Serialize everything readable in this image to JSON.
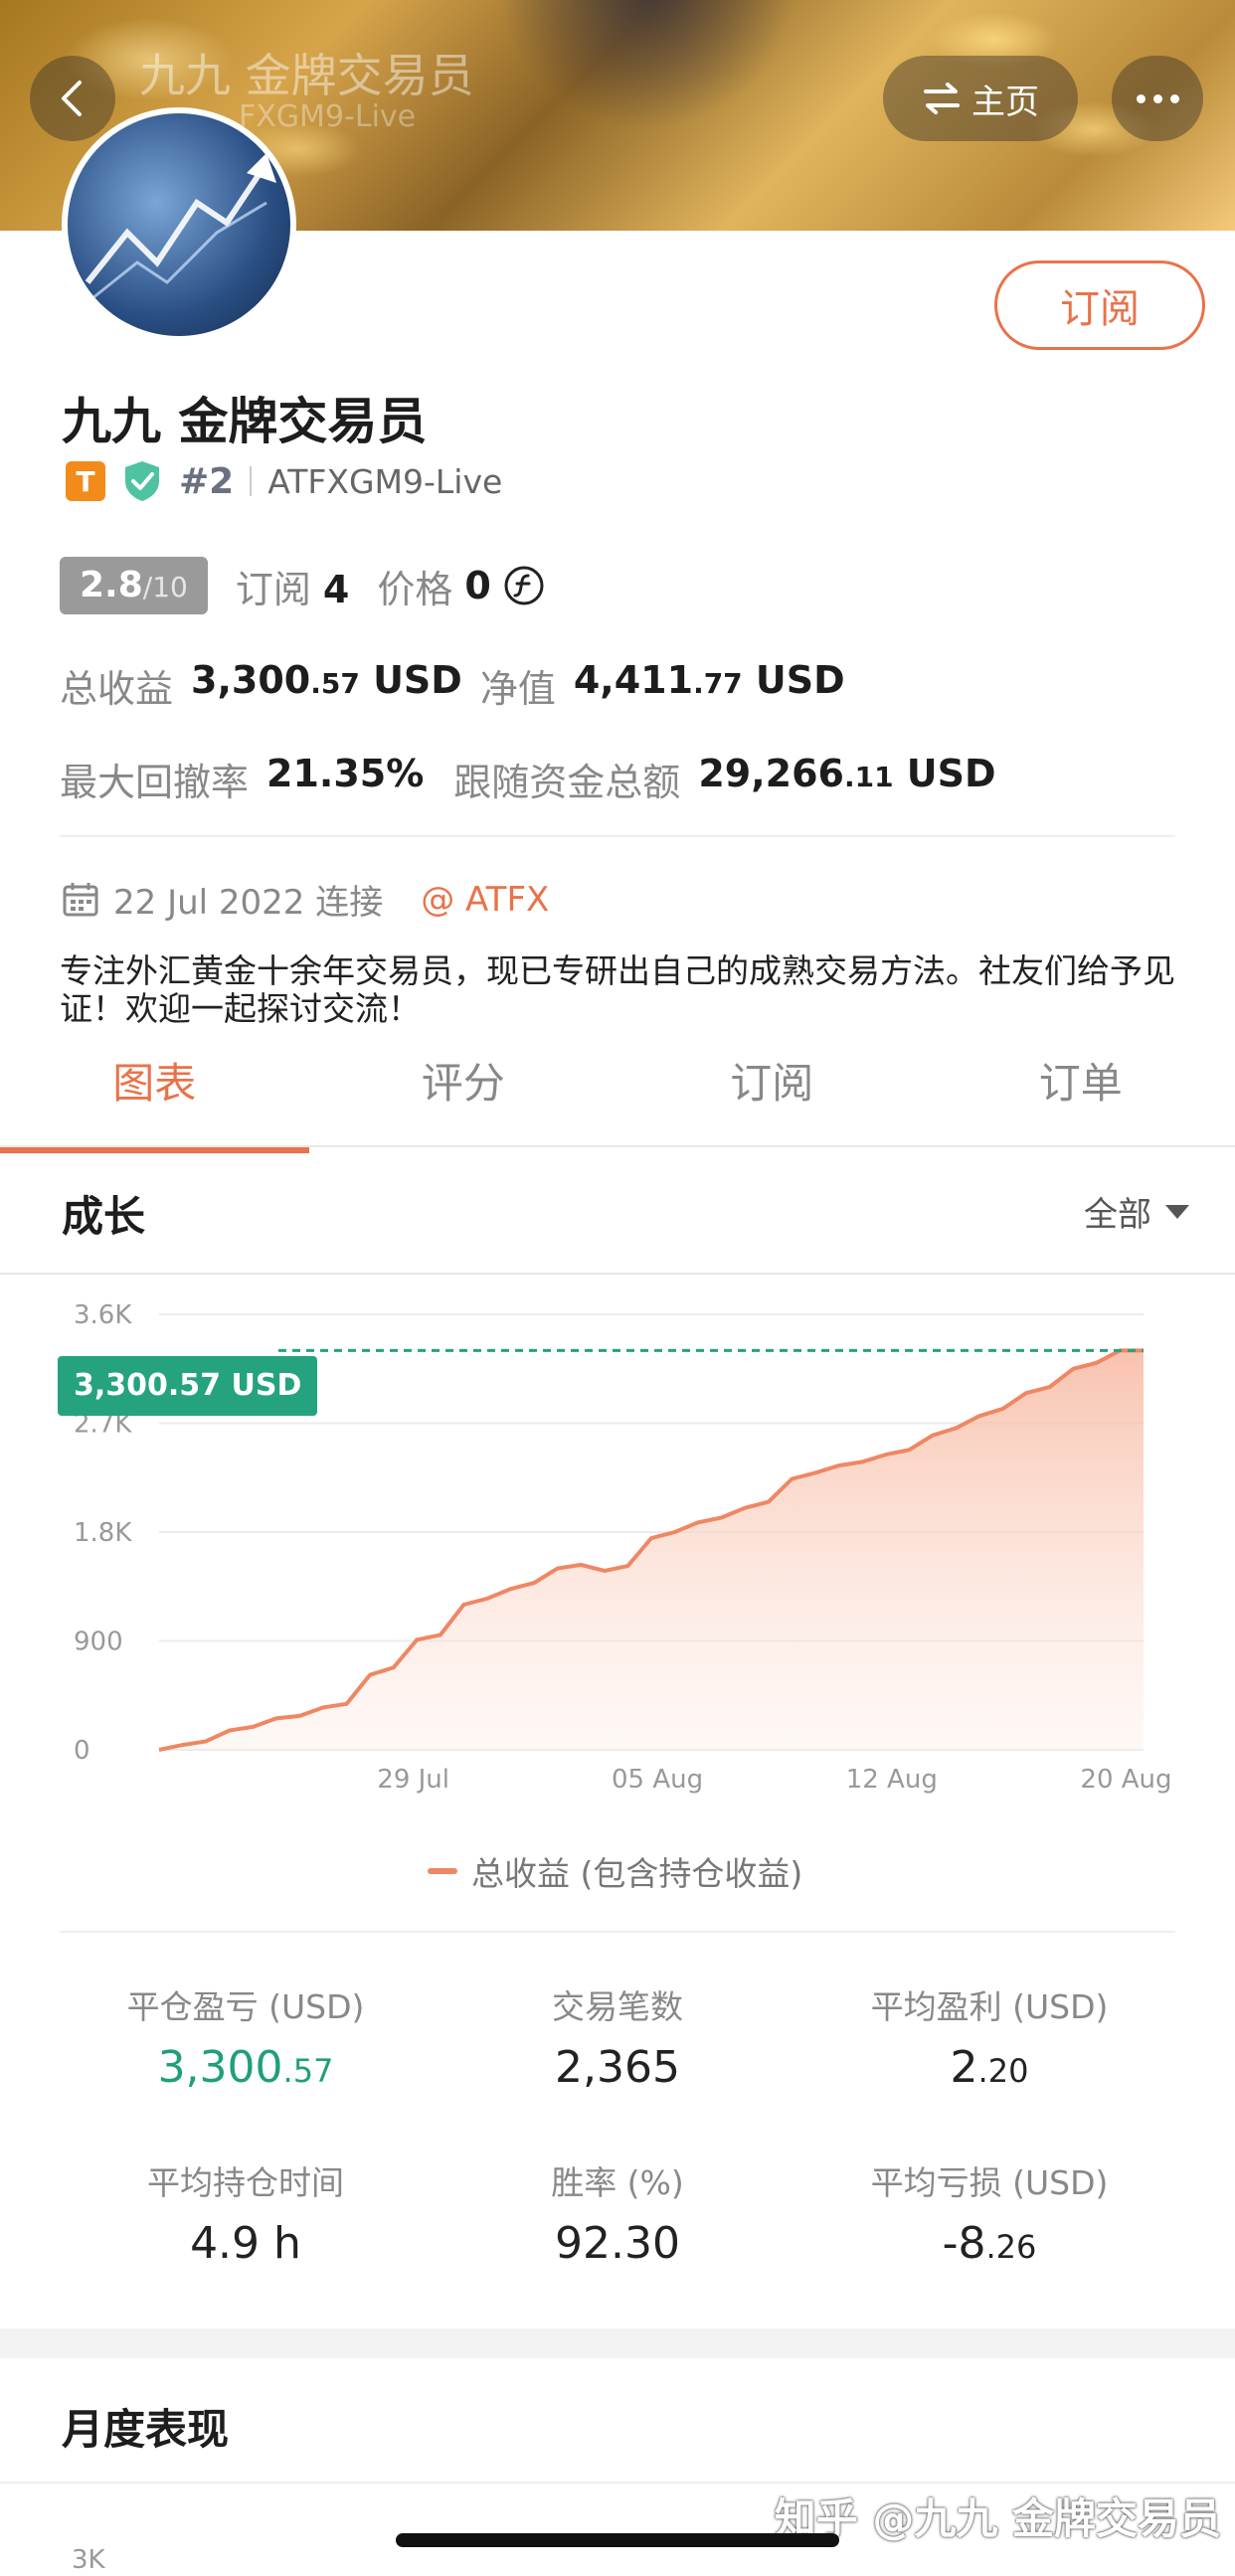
{
  "banner": {
    "faded_title": "九九 金牌交易员",
    "faded_sub": "FXGM9-Live",
    "home_label": "主页"
  },
  "profile": {
    "subscribe_label": "订阅",
    "name": "九九 金牌交易员",
    "tier_badge": "T",
    "rank": "#2",
    "account": "ATFXGM9-Live"
  },
  "stats": {
    "score": "2.8",
    "score_max": "/10",
    "subs_label": "订阅",
    "subs_value": "4",
    "price_label": "价格",
    "price_value": "0",
    "total_profit_label": "总收益",
    "total_profit_int": "3,300",
    "total_profit_dec": ".57",
    "total_profit_unit": "USD",
    "equity_label": "净值",
    "equity_int": "4,411",
    "equity_dec": ".77",
    "equity_unit": "USD",
    "drawdown_label": "最大回撤率",
    "drawdown_value": "21.35%",
    "follow_label": "跟随资金总额",
    "follow_int": "29,266",
    "follow_dec": ".11",
    "follow_unit": "USD"
  },
  "meta": {
    "date": "22 Jul 2022 连接",
    "broker": "@ ATFX"
  },
  "bio": "专注外汇黄金十余年交易员，现已专研出自己的成熟交易方法。社友们给予见证！欢迎一起探讨交流！",
  "tabs": [
    "图表",
    "评分",
    "订阅",
    "订单"
  ],
  "growth": {
    "title": "成长",
    "range": "全部",
    "current_tag": "3,300.57 USD",
    "legend": "总收益 (包含持仓收益)"
  },
  "chart_data": {
    "type": "area",
    "title": "",
    "xlabel": "",
    "ylabel": "",
    "ylim": [
      0,
      3600
    ],
    "y_ticks": [
      "0",
      "900",
      "1.8K",
      "2.7K",
      "3.6K"
    ],
    "x_ticks": [
      "29 Jul",
      "05 Aug",
      "12 Aug",
      "20 Aug"
    ],
    "series": [
      {
        "name": "总收益 (包含持仓收益)",
        "values": [
          0,
          40,
          70,
          160,
          190,
          260,
          280,
          350,
          380,
          620,
          680,
          910,
          950,
          1200,
          1250,
          1330,
          1380,
          1500,
          1530,
          1480,
          1520,
          1750,
          1800,
          1880,
          1920,
          2000,
          2050,
          2240,
          2290,
          2350,
          2380,
          2440,
          2480,
          2600,
          2660,
          2760,
          2820,
          2950,
          3000,
          3150,
          3200,
          3300.57,
          3300.57
        ]
      }
    ],
    "reference_line": 3300.57,
    "colors": {
      "line": "#ef8763",
      "fill": "#fbd9cc",
      "reference": "#24a37e"
    },
    "grid": true
  },
  "summary": [
    {
      "label": "平仓盈亏 (USD)",
      "int": "3,300",
      "dec": ".57",
      "accent": true
    },
    {
      "label": "交易笔数",
      "int": "2,365",
      "dec": ""
    },
    {
      "label": "平均盈利 (USD)",
      "int": "2",
      "dec": ".20"
    },
    {
      "label": "平均持仓时间",
      "int": "4.9 h",
      "dec": ""
    },
    {
      "label": "胜率 (%)",
      "int": "92.30",
      "dec": ""
    },
    {
      "label": "平均亏损 (USD)",
      "int": "-8",
      "dec": ".26"
    }
  ],
  "monthly": {
    "title": "月度表现",
    "axis_top": "3K"
  },
  "watermark": "知乎 @九九 金牌交易员",
  "colors": {
    "accent": "#e8734a",
    "green": "#24a37e"
  }
}
